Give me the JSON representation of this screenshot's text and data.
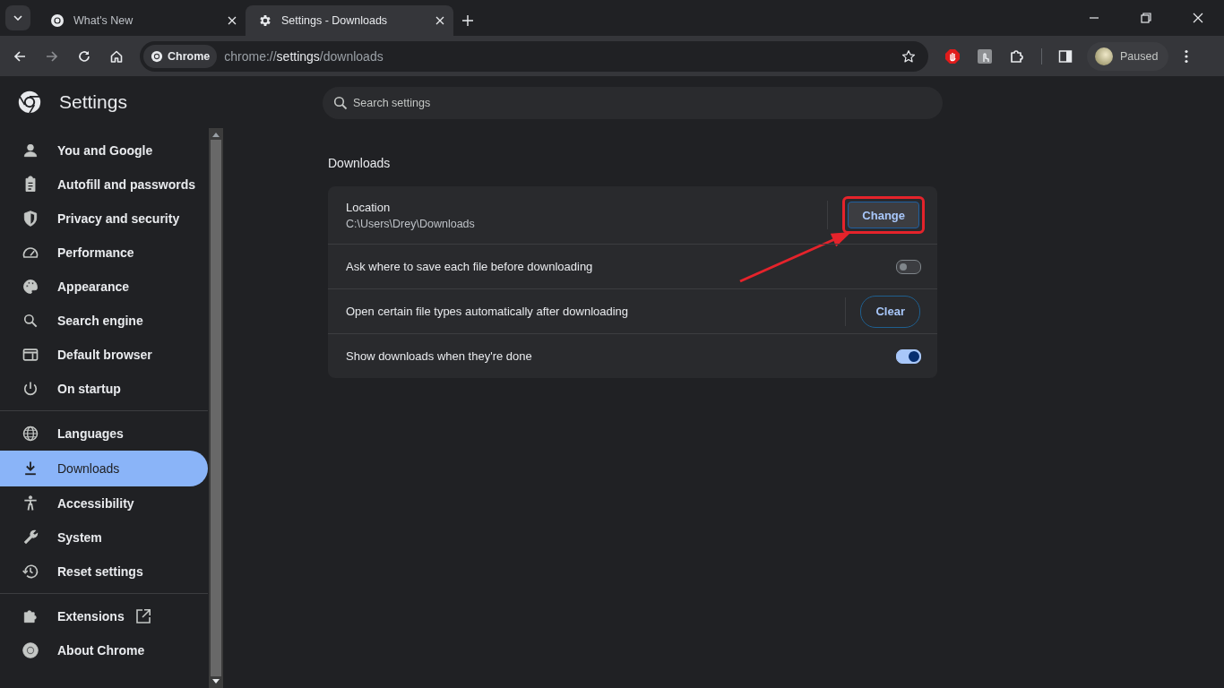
{
  "tabs": [
    {
      "title": "What's New",
      "selected": false
    },
    {
      "title": "Settings - Downloads",
      "selected": true
    }
  ],
  "omnibox": {
    "chip": "Chrome",
    "url_parts": [
      {
        "text": "chrome://",
        "emphasized": false
      },
      {
        "text": "settings",
        "emphasized": true
      },
      {
        "text": "/downloads",
        "emphasized": false
      }
    ]
  },
  "profile": {
    "status": "Paused"
  },
  "sidebar": {
    "title": "Settings",
    "groups": [
      [
        {
          "label": "You and Google",
          "selected": false
        },
        {
          "label": "Autofill and passwords",
          "selected": false
        },
        {
          "label": "Privacy and security",
          "selected": false
        },
        {
          "label": "Performance",
          "selected": false
        },
        {
          "label": "Appearance",
          "selected": false
        },
        {
          "label": "Search engine",
          "selected": false
        },
        {
          "label": "Default browser",
          "selected": false
        },
        {
          "label": "On startup",
          "selected": false
        }
      ],
      [
        {
          "label": "Languages",
          "selected": false
        },
        {
          "label": "Downloads",
          "selected": true
        },
        {
          "label": "Accessibility",
          "selected": false
        },
        {
          "label": "System",
          "selected": false
        },
        {
          "label": "Reset settings",
          "selected": false
        }
      ],
      [
        {
          "label": "Extensions",
          "selected": false,
          "external_link": true
        },
        {
          "label": "About Chrome",
          "selected": false
        }
      ]
    ]
  },
  "search": {
    "placeholder": "Search settings"
  },
  "section": {
    "title": "Downloads",
    "rows": [
      {
        "kind": "path",
        "label": "Location",
        "value": "C:\\Users\\Drey\\Downloads",
        "button": "Change",
        "highlighted": true
      },
      {
        "kind": "toggle",
        "label": "Ask where to save each file before downloading",
        "on": false
      },
      {
        "kind": "button",
        "label": "Open certain file types automatically after downloading",
        "button": "Clear"
      },
      {
        "kind": "toggle",
        "label": "Show downloads when they're done",
        "on": true
      }
    ]
  }
}
